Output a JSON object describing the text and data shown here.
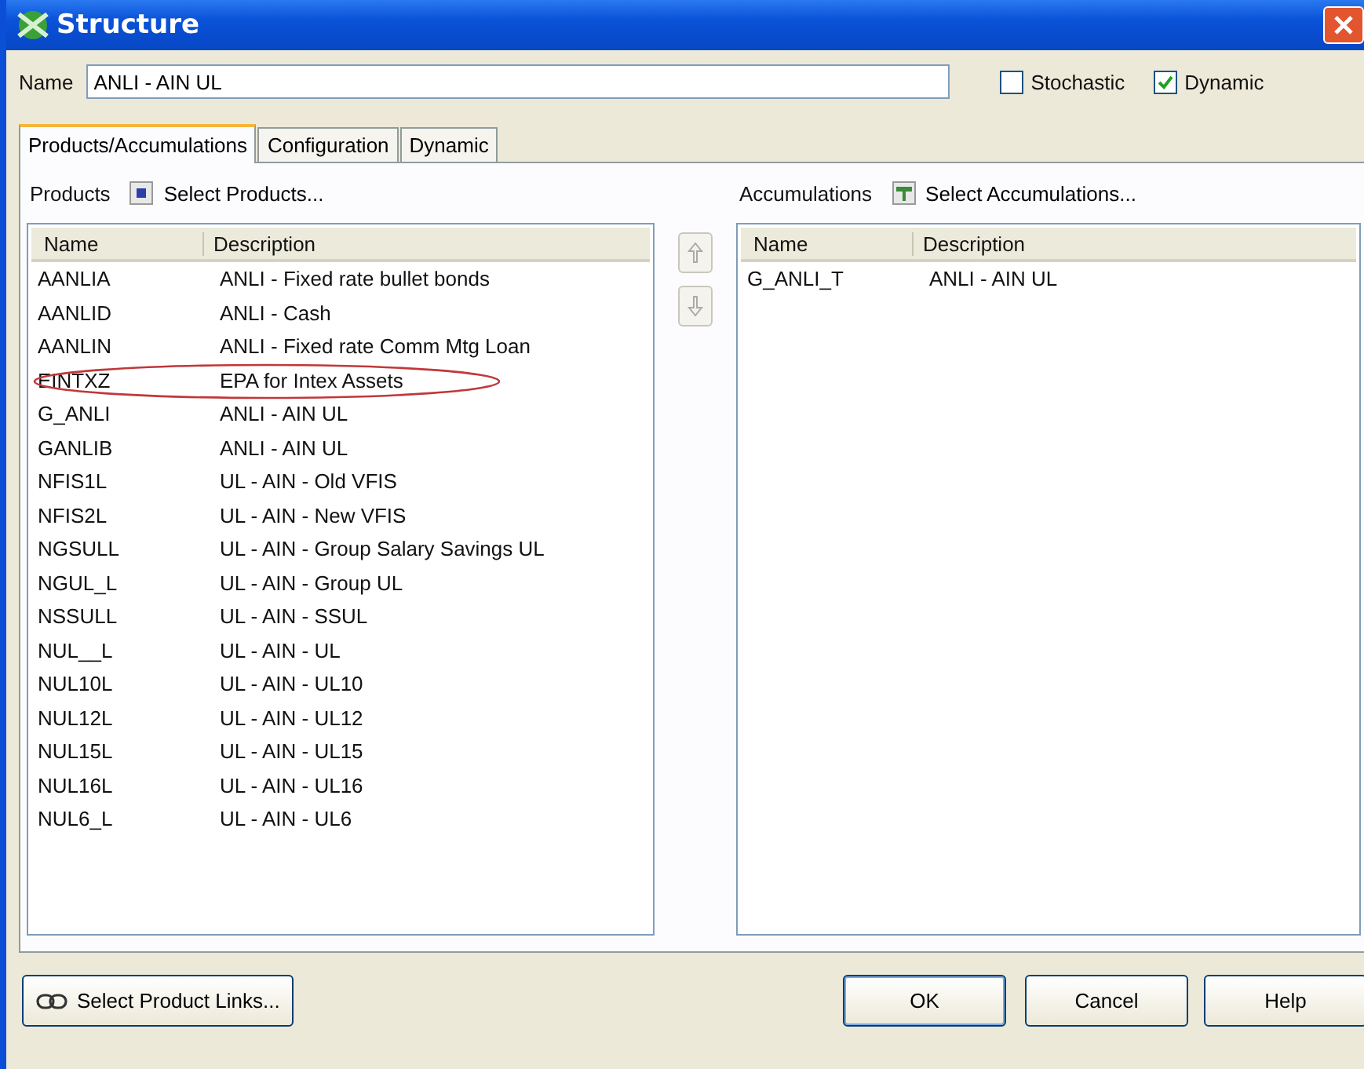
{
  "window": {
    "title": "Structure"
  },
  "name_field": {
    "label": "Name",
    "value": "ANLI - AIN UL"
  },
  "options": [
    {
      "label": "Stochastic",
      "checked": false
    },
    {
      "label": "Dynamic",
      "checked": true
    }
  ],
  "tabs": [
    {
      "label": "Products/Accumulations",
      "selected": true
    },
    {
      "label": "Configuration",
      "selected": false
    },
    {
      "label": "Dynamic",
      "selected": false
    }
  ],
  "products": {
    "label": "Products",
    "action": "Select Products...",
    "columns": [
      "Name",
      "Description"
    ],
    "rows": [
      {
        "name": "AANLIA",
        "description": "ANLI - Fixed rate bullet bonds",
        "circled": false
      },
      {
        "name": "AANLID",
        "description": "ANLI - Cash",
        "circled": false
      },
      {
        "name": "AANLIN",
        "description": "ANLI - Fixed rate Comm Mtg Loan",
        "circled": false
      },
      {
        "name": "EINTXZ",
        "description": "EPA for Intex Assets",
        "circled": true
      },
      {
        "name": "G_ANLI",
        "description": "ANLI - AIN UL",
        "circled": false
      },
      {
        "name": "GANLIB",
        "description": "ANLI - AIN UL",
        "circled": false
      },
      {
        "name": "NFIS1L",
        "description": "UL - AIN - Old VFIS",
        "circled": false
      },
      {
        "name": "NFIS2L",
        "description": "UL - AIN - New VFIS",
        "circled": false
      },
      {
        "name": "NGSULL",
        "description": "UL - AIN - Group Salary Savings UL",
        "circled": false
      },
      {
        "name": "NGUL_L",
        "description": "UL - AIN - Group UL",
        "circled": false
      },
      {
        "name": "NSSULL",
        "description": "UL - AIN - SSUL",
        "circled": false
      },
      {
        "name": "NUL__L",
        "description": "UL - AIN - UL",
        "circled": false
      },
      {
        "name": "NUL10L",
        "description": "UL - AIN - UL10",
        "circled": false
      },
      {
        "name": "NUL12L",
        "description": "UL - AIN - UL12",
        "circled": false
      },
      {
        "name": "NUL15L",
        "description": "UL - AIN - UL15",
        "circled": false
      },
      {
        "name": "NUL16L",
        "description": "UL - AIN - UL16",
        "circled": false
      },
      {
        "name": "NUL6_L",
        "description": "UL - AIN - UL6",
        "circled": false
      }
    ]
  },
  "accumulations": {
    "label": "Accumulations",
    "action": "Select Accumulations...",
    "columns": [
      "Name",
      "Description"
    ],
    "rows": [
      {
        "name": "G_ANLI_T",
        "description": "ANLI - AIN UL"
      }
    ]
  },
  "buttons": {
    "links": "Select Product Links...",
    "ok": "OK",
    "cancel": "Cancel",
    "help": "Help"
  }
}
